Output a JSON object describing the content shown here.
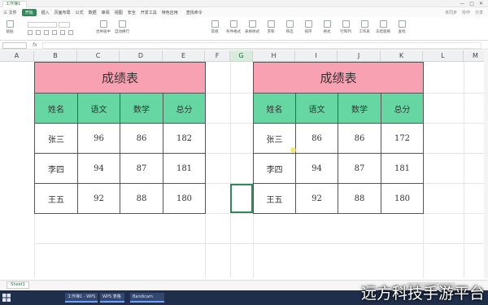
{
  "titlebar": {
    "doc_tab": "工作簿1",
    "controls": [
      "—",
      "□",
      "✕"
    ]
  },
  "menubar": {
    "items": [
      "三 文件",
      "开始",
      "插入",
      "页面布局",
      "公式",
      "数据",
      "审阅",
      "视图",
      "安全",
      "开发工具",
      "特色应用"
    ],
    "search": "查找命令",
    "right": [
      "未同步",
      "协作",
      "分享"
    ]
  },
  "toolbar": {
    "groups_left": [
      "粘贴",
      "剪切",
      "复制",
      "格式刷"
    ],
    "groups_mid": [
      "合并居中",
      "自动换行"
    ],
    "groups_right": [
      "常规",
      "条件格式",
      "表格样式",
      "求和",
      "筛选",
      "排序",
      "格式",
      "行和列",
      "工作表",
      "冻结窗格",
      "查找"
    ]
  },
  "formula_bar": {
    "fx": "fx"
  },
  "columns": [
    "A",
    "B",
    "C",
    "D",
    "E",
    "F",
    "G",
    "H",
    "I",
    "J",
    "K",
    "L",
    "M"
  ],
  "active_column": "G",
  "table_left": {
    "title": "成绩表",
    "headers": [
      "姓名",
      "语文",
      "数学",
      "总分"
    ],
    "rows": [
      [
        "张三",
        "96",
        "86",
        "182"
      ],
      [
        "李四",
        "94",
        "87",
        "181"
      ],
      [
        "王五",
        "92",
        "88",
        "180"
      ]
    ]
  },
  "table_right": {
    "title": "成绩表",
    "headers": [
      "姓名",
      "语文",
      "数学",
      "总分"
    ],
    "rows": [
      [
        "张三",
        "86",
        "86",
        "172"
      ],
      [
        "李四",
        "94",
        "87",
        "181"
      ],
      [
        "王五",
        "92",
        "88",
        "180"
      ]
    ]
  },
  "statusbar": {
    "sheet_tab": "Sheet1"
  },
  "taskbar": {
    "items": [
      "工作簿1 - WPS",
      "WPS 表格",
      "Bandicam"
    ]
  },
  "watermark": "远方科技手游平台",
  "colors": {
    "title_fill": "#f7a1b2",
    "header_fill": "#66d6a3",
    "accent": "#2e8b57"
  }
}
